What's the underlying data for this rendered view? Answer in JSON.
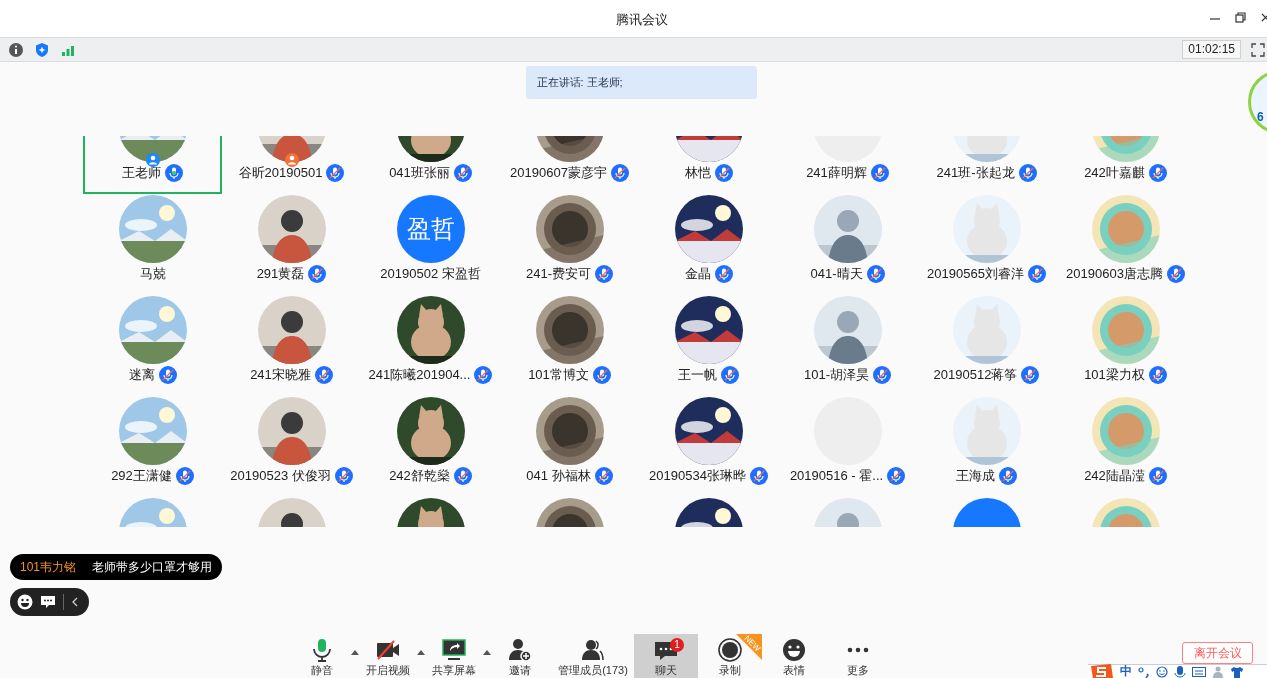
{
  "window": {
    "title": "腾讯会议"
  },
  "info_bar": {
    "timer": "01:02:15"
  },
  "speaking_banner": "正在讲话: 王老师;",
  "side_widget": {
    "text": "6"
  },
  "participants": [
    {
      "name": "王老师",
      "kind": "picture",
      "muted": false,
      "host": true,
      "selected": true
    },
    {
      "name": "谷昕20190501",
      "kind": "picture",
      "muted": true,
      "host": false,
      "selected": false
    },
    {
      "name": "041班张丽",
      "kind": "picture",
      "muted": true,
      "selected": false
    },
    {
      "name": "20190607蒙彦宇",
      "kind": "picture",
      "muted": true,
      "selected": false
    },
    {
      "name": "林恺",
      "kind": "picture",
      "muted": true,
      "selected": false
    },
    {
      "name": "241薛明辉",
      "kind": "empty",
      "muted": true,
      "selected": false
    },
    {
      "name": "241班-张起龙",
      "kind": "picture",
      "muted": true,
      "selected": false
    },
    {
      "name": "242叶嘉麒",
      "kind": "picture",
      "muted": true,
      "selected": false
    },
    {
      "name": "马兢",
      "kind": "picture",
      "selected": false
    },
    {
      "name": "291黄磊",
      "kind": "picture",
      "muted": true,
      "selected": false
    },
    {
      "name": "20190502 宋盈哲",
      "kind": "initials",
      "initials": "盈哲",
      "selected": false
    },
    {
      "name": "241-费安可",
      "kind": "picture",
      "muted": true,
      "selected": false
    },
    {
      "name": "金晶",
      "kind": "picture",
      "muted": true,
      "selected": false
    },
    {
      "name": "041-晴天",
      "kind": "picture",
      "muted": true,
      "selected": false
    },
    {
      "name": "20190565刘睿洋",
      "kind": "picture",
      "muted": true,
      "selected": false
    },
    {
      "name": "20190603唐志腾",
      "kind": "picture",
      "muted": true,
      "selected": false
    },
    {
      "name": "迷离",
      "kind": "picture",
      "muted": true,
      "selected": false
    },
    {
      "name": "241宋晓雅",
      "kind": "picture",
      "muted": true,
      "selected": false
    },
    {
      "name": "241陈曦201904...",
      "kind": "picture",
      "muted": true,
      "selected": false
    },
    {
      "name": "101常博文",
      "kind": "picture",
      "muted": true,
      "selected": false
    },
    {
      "name": "王一帆",
      "kind": "picture",
      "muted": true,
      "selected": false
    },
    {
      "name": "101-胡泽昊",
      "kind": "picture",
      "muted": true,
      "selected": false
    },
    {
      "name": "20190512蒋筝",
      "kind": "picture",
      "muted": true,
      "selected": false
    },
    {
      "name": "101梁力权",
      "kind": "picture",
      "muted": true,
      "selected": false
    },
    {
      "name": "292王潇健",
      "kind": "picture",
      "muted": true,
      "selected": false
    },
    {
      "name": "20190523 伏俊羽",
      "kind": "picture",
      "muted": true,
      "selected": false
    },
    {
      "name": "242舒乾燊",
      "kind": "picture",
      "muted": true,
      "selected": false
    },
    {
      "name": "041 孙福林",
      "kind": "picture",
      "muted": true,
      "selected": false
    },
    {
      "name": "20190534张琳晔",
      "kind": "picture",
      "muted": true,
      "selected": false
    },
    {
      "name": "20190516 - 霍...",
      "kind": "empty",
      "muted": true,
      "selected": false
    },
    {
      "name": "王海成",
      "kind": "picture",
      "muted": true,
      "selected": false
    },
    {
      "name": "242陆晶滢",
      "kind": "picture",
      "muted": true,
      "selected": false
    },
    {
      "kind": "picture",
      "selected": false
    },
    {
      "kind": "picture",
      "selected": false
    },
    {
      "kind": "picture",
      "selected": false
    },
    {
      "kind": "picture",
      "selected": false
    },
    {
      "kind": "picture",
      "selected": false
    },
    {
      "kind": "picture",
      "selected": false
    },
    {
      "kind": "initials",
      "selected": false
    },
    {
      "kind": "picture",
      "selected": false
    }
  ],
  "chat_popup": {
    "sender": "101韦力铭",
    "message": "老师带多少口罩才够用"
  },
  "toolbar": [
    {
      "kind": "mic",
      "label": "静音",
      "caret": true,
      "selected": false
    },
    {
      "kind": "video",
      "label": "开启视频",
      "caret": true,
      "selected": false
    },
    {
      "kind": "share",
      "label": "共享屏幕",
      "caret": true,
      "selected": false
    },
    {
      "kind": "invite",
      "label": "邀请",
      "selected": false
    },
    {
      "kind": "members",
      "label": "管理成员(173)",
      "selected": false
    },
    {
      "kind": "chat",
      "label": "聊天",
      "badge": "1",
      "selected": true
    },
    {
      "kind": "record",
      "label": "录制",
      "ribbon": "NEW",
      "selected": false
    },
    {
      "kind": "emoji",
      "label": "表情",
      "selected": false
    },
    {
      "kind": "more",
      "label": "更多",
      "selected": false
    }
  ],
  "leave_button": "离开会议",
  "ime_bar": {
    "mode": "中"
  }
}
